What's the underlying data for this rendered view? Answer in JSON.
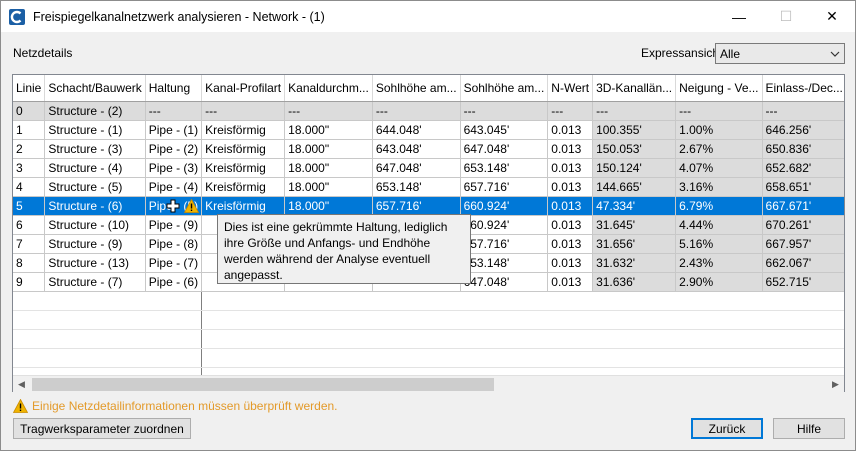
{
  "window": {
    "title": "Freispiegelkanalnetzwerk analysieren - Network - (1)",
    "minimize_glyph": "—",
    "maximize_glyph": "☐",
    "close_glyph": "✕"
  },
  "netzdetails_label": "Netzdetails",
  "expressansicht": {
    "label": "Expressansicht",
    "selected": "Alle"
  },
  "columns": [
    "Linie",
    "Schacht/Bauwerk",
    "Haltung",
    "Kanal-Profilart",
    "Kanaldurchm...",
    "Sohlhöhe am...",
    "Sohlhöhe am...",
    "N-Wert",
    "3D-Kanallän...",
    "Neigung - Ve...",
    "Einlass-/Dec..."
  ],
  "rows": [
    {
      "linie": "0",
      "schacht": "Structure - (2)",
      "haltung": "---",
      "profil": "---",
      "durchm": "---",
      "sohle1": "---",
      "sohle2": "---",
      "nwert": "---",
      "laenge": "---",
      "neigung": "---",
      "einlass": "---"
    },
    {
      "linie": "1",
      "schacht": "Structure - (1)",
      "haltung": "Pipe - (1)",
      "profil": "Kreisförmig",
      "durchm": "18.000\"",
      "sohle1": "644.048'",
      "sohle2": "643.045'",
      "nwert": "0.013",
      "laenge": "100.355'",
      "neigung": "1.00%",
      "einlass": "646.256'"
    },
    {
      "linie": "2",
      "schacht": "Structure - (3)",
      "haltung": "Pipe - (2)",
      "profil": "Kreisförmig",
      "durchm": "18.000\"",
      "sohle1": "643.048'",
      "sohle2": "647.048'",
      "nwert": "0.013",
      "laenge": "150.053'",
      "neigung": "2.67%",
      "einlass": "650.836'"
    },
    {
      "linie": "3",
      "schacht": "Structure - (4)",
      "haltung": "Pipe - (3)",
      "profil": "Kreisförmig",
      "durchm": "18.000\"",
      "sohle1": "647.048'",
      "sohle2": "653.148'",
      "nwert": "0.013",
      "laenge": "150.124'",
      "neigung": "4.07%",
      "einlass": "652.682'"
    },
    {
      "linie": "4",
      "schacht": "Structure - (5)",
      "haltung": "Pipe - (4)",
      "profil": "Kreisförmig",
      "durchm": "18.000\"",
      "sohle1": "653.148'",
      "sohle2": "657.716'",
      "nwert": "0.013",
      "laenge": "144.665'",
      "neigung": "3.16%",
      "einlass": "658.651'"
    },
    {
      "linie": "5",
      "schacht": "Structure - (6)",
      "haltung": "Pipe - (5)",
      "profil": "Kreisförmig",
      "durchm": "18.000\"",
      "sohle1": "657.716'",
      "sohle2": "660.924'",
      "nwert": "0.013",
      "laenge": "47.334'",
      "neigung": "6.79%",
      "einlass": "667.671'"
    },
    {
      "linie": "6",
      "schacht": "Structure - (10)",
      "haltung": "Pipe - (9)",
      "profil": "",
      "durchm": "",
      "sohle1": "",
      "sohle2": "660.924'",
      "nwert": "0.013",
      "laenge": "31.645'",
      "neigung": "4.44%",
      "einlass": "670.261'"
    },
    {
      "linie": "7",
      "schacht": "Structure - (9)",
      "haltung": "Pipe - (8)",
      "profil": "",
      "durchm": "",
      "sohle1": "",
      "sohle2": "657.716'",
      "nwert": "0.013",
      "laenge": "31.656'",
      "neigung": "5.16%",
      "einlass": "667.957'"
    },
    {
      "linie": "8",
      "schacht": "Structure - (13)",
      "haltung": "Pipe - (7)",
      "profil": "",
      "durchm": "",
      "sohle1": "",
      "sohle2": "653.148'",
      "nwert": "0.013",
      "laenge": "31.632'",
      "neigung": "2.43%",
      "einlass": "662.067'"
    },
    {
      "linie": "9",
      "schacht": "Structure - (7)",
      "haltung": "Pipe - (6)",
      "profil": "",
      "durchm": "",
      "sohle1": "",
      "sohle2": "647.048'",
      "nwert": "0.013",
      "laenge": "31.636'",
      "neigung": "2.90%",
      "einlass": "652.715'"
    }
  ],
  "selected_row_index": 5,
  "tooltip": {
    "text": "Dies ist eine gekrümmte Haltung, lediglich ihre Größe und Anfangs- und Endhöhe werden während der Analyse eventuell angepasst."
  },
  "warning_message": "Einige Netzdetailinformationen müssen überprüft werden.",
  "buttons": {
    "tragwerk": "Tragwerksparameter zuordnen",
    "zurueck": "Zurück",
    "hilfe": "Hilfe"
  },
  "colors": {
    "selection": "#0078d7",
    "readonly_cell": "#dcdcdc",
    "warning_text": "#e39a2a",
    "warning_icon": "#f0b400"
  },
  "icons": {
    "app": "civil3d-app-icon",
    "warning": "warning-triangle-icon",
    "dropdown": "chevron-down-icon"
  }
}
